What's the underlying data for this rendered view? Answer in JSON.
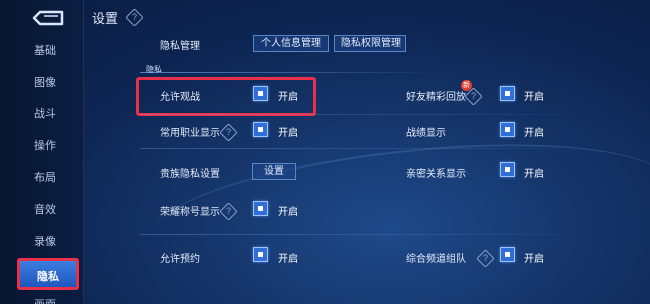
{
  "sidebar": {
    "items": [
      {
        "label": "基础"
      },
      {
        "label": "图像"
      },
      {
        "label": "战斗"
      },
      {
        "label": "操作"
      },
      {
        "label": "布局"
      },
      {
        "label": "音效"
      },
      {
        "label": "录像"
      },
      {
        "label": "隐私"
      },
      {
        "label": "画面"
      }
    ],
    "active": "隐私"
  },
  "header": {
    "title": "设置",
    "help_icon": "question-diamond"
  },
  "privacy_management": {
    "label": "隐私管理",
    "buttons": [
      "个人信息管理",
      "隐私权限管理"
    ]
  },
  "section": {
    "tab": "隐私"
  },
  "settings": {
    "allow_spectate": {
      "label": "允许观战",
      "state": "开启"
    },
    "friend_highlights": {
      "label": "好友精彩回放",
      "state": "开启",
      "badge": "新"
    },
    "common_roles": {
      "label": "常用职业显示",
      "state": "开启"
    },
    "battle_record": {
      "label": "战绩显示",
      "state": "开启"
    },
    "noble_privacy": {
      "label": "贵族隐私设置",
      "button": "设置"
    },
    "intimate_relation": {
      "label": "亲密关系显示",
      "state": "开启"
    },
    "honor_title": {
      "label": "荣耀称号显示",
      "state": "开启"
    },
    "allow_reservation": {
      "label": "允许预约",
      "state": "开启"
    },
    "channel_team": {
      "label": "综合频道组队",
      "state": "开启"
    }
  },
  "colors": {
    "accent": "#2f6fd6",
    "highlight": "#e8304a",
    "badge": "#e2402e"
  }
}
